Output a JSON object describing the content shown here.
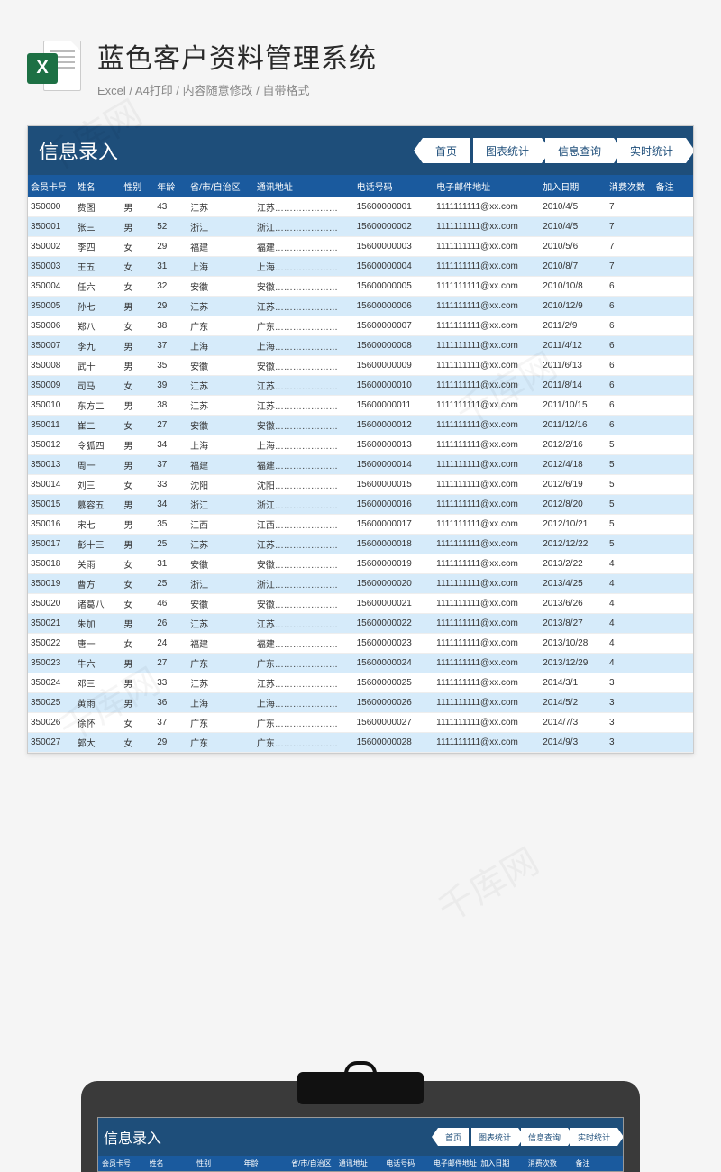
{
  "page_title": "蓝色客户资料管理系统",
  "page_subtitle": "Excel / A4打印 / 内容随意修改 / 自带格式",
  "excel_badge": "X",
  "sheet_title": "信息录入",
  "nav": [
    "首页",
    "图表统计",
    "信息查询",
    "实时统计"
  ],
  "columns": [
    "会员卡号",
    "姓名",
    "性别",
    "年龄",
    "省/市/自治区",
    "通讯地址",
    "电话号码",
    "电子邮件地址",
    "加入日期",
    "消费次数",
    "备注"
  ],
  "rows": [
    [
      "350000",
      "费图",
      "男",
      "43",
      "江苏",
      "江苏…………………",
      "15600000001",
      "1111111111@xx.com",
      "2010/4/5",
      "7",
      ""
    ],
    [
      "350001",
      "张三",
      "男",
      "52",
      "浙江",
      "浙江…………………",
      "15600000002",
      "1111111111@xx.com",
      "2010/4/5",
      "7",
      ""
    ],
    [
      "350002",
      "李四",
      "女",
      "29",
      "福建",
      "福建…………………",
      "15600000003",
      "1111111111@xx.com",
      "2010/5/6",
      "7",
      ""
    ],
    [
      "350003",
      "王五",
      "女",
      "31",
      "上海",
      "上海…………………",
      "15600000004",
      "1111111111@xx.com",
      "2010/8/7",
      "7",
      ""
    ],
    [
      "350004",
      "任六",
      "女",
      "32",
      "安徽",
      "安徽…………………",
      "15600000005",
      "1111111111@xx.com",
      "2010/10/8",
      "6",
      ""
    ],
    [
      "350005",
      "孙七",
      "男",
      "29",
      "江苏",
      "江苏…………………",
      "15600000006",
      "1111111111@xx.com",
      "2010/12/9",
      "6",
      ""
    ],
    [
      "350006",
      "郑八",
      "女",
      "38",
      "广东",
      "广东…………………",
      "15600000007",
      "1111111111@xx.com",
      "2011/2/9",
      "6",
      ""
    ],
    [
      "350007",
      "李九",
      "男",
      "37",
      "上海",
      "上海…………………",
      "15600000008",
      "1111111111@xx.com",
      "2011/4/12",
      "6",
      ""
    ],
    [
      "350008",
      "武十",
      "男",
      "35",
      "安徽",
      "安徽…………………",
      "15600000009",
      "1111111111@xx.com",
      "2011/6/13",
      "6",
      ""
    ],
    [
      "350009",
      "司马",
      "女",
      "39",
      "江苏",
      "江苏…………………",
      "15600000010",
      "1111111111@xx.com",
      "2011/8/14",
      "6",
      ""
    ],
    [
      "350010",
      "东方二",
      "男",
      "38",
      "江苏",
      "江苏…………………",
      "15600000011",
      "1111111111@xx.com",
      "2011/10/15",
      "6",
      ""
    ],
    [
      "350011",
      "崔二",
      "女",
      "27",
      "安徽",
      "安徽…………………",
      "15600000012",
      "1111111111@xx.com",
      "2011/12/16",
      "6",
      ""
    ],
    [
      "350012",
      "令狐四",
      "男",
      "34",
      "上海",
      "上海…………………",
      "15600000013",
      "1111111111@xx.com",
      "2012/2/16",
      "5",
      ""
    ],
    [
      "350013",
      "周一",
      "男",
      "37",
      "福建",
      "福建…………………",
      "15600000014",
      "1111111111@xx.com",
      "2012/4/18",
      "5",
      ""
    ],
    [
      "350014",
      "刘三",
      "女",
      "33",
      "沈阳",
      "沈阳…………………",
      "15600000015",
      "1111111111@xx.com",
      "2012/6/19",
      "5",
      ""
    ],
    [
      "350015",
      "慕容五",
      "男",
      "34",
      "浙江",
      "浙江…………………",
      "15600000016",
      "1111111111@xx.com",
      "2012/8/20",
      "5",
      ""
    ],
    [
      "350016",
      "宋七",
      "男",
      "35",
      "江西",
      "江西…………………",
      "15600000017",
      "1111111111@xx.com",
      "2012/10/21",
      "5",
      ""
    ],
    [
      "350017",
      "彭十三",
      "男",
      "25",
      "江苏",
      "江苏…………………",
      "15600000018",
      "1111111111@xx.com",
      "2012/12/22",
      "5",
      ""
    ],
    [
      "350018",
      "关雨",
      "女",
      "31",
      "安徽",
      "安徽…………………",
      "15600000019",
      "1111111111@xx.com",
      "2013/2/22",
      "4",
      ""
    ],
    [
      "350019",
      "曹方",
      "女",
      "25",
      "浙江",
      "浙江…………………",
      "15600000020",
      "1111111111@xx.com",
      "2013/4/25",
      "4",
      ""
    ],
    [
      "350020",
      "诸葛八",
      "女",
      "46",
      "安徽",
      "安徽…………………",
      "15600000021",
      "1111111111@xx.com",
      "2013/6/26",
      "4",
      ""
    ],
    [
      "350021",
      "朱加",
      "男",
      "26",
      "江苏",
      "江苏…………………",
      "15600000022",
      "1111111111@xx.com",
      "2013/8/27",
      "4",
      ""
    ],
    [
      "350022",
      "唐一",
      "女",
      "24",
      "福建",
      "福建…………………",
      "15600000023",
      "1111111111@xx.com",
      "2013/10/28",
      "4",
      ""
    ],
    [
      "350023",
      "牛六",
      "男",
      "27",
      "广东",
      "广东…………………",
      "15600000024",
      "1111111111@xx.com",
      "2013/12/29",
      "4",
      ""
    ],
    [
      "350024",
      "邓三",
      "男",
      "33",
      "江苏",
      "江苏…………………",
      "15600000025",
      "1111111111@xx.com",
      "2014/3/1",
      "3",
      ""
    ],
    [
      "350025",
      "黄雨",
      "男",
      "36",
      "上海",
      "上海…………………",
      "15600000026",
      "1111111111@xx.com",
      "2014/5/2",
      "3",
      ""
    ],
    [
      "350026",
      "徐怀",
      "女",
      "37",
      "广东",
      "广东…………………",
      "15600000027",
      "1111111111@xx.com",
      "2014/7/3",
      "3",
      ""
    ],
    [
      "350027",
      "郭大",
      "女",
      "29",
      "广东",
      "广东…………………",
      "15600000028",
      "1111111111@xx.com",
      "2014/9/3",
      "3",
      ""
    ]
  ],
  "watermark": "千库网"
}
